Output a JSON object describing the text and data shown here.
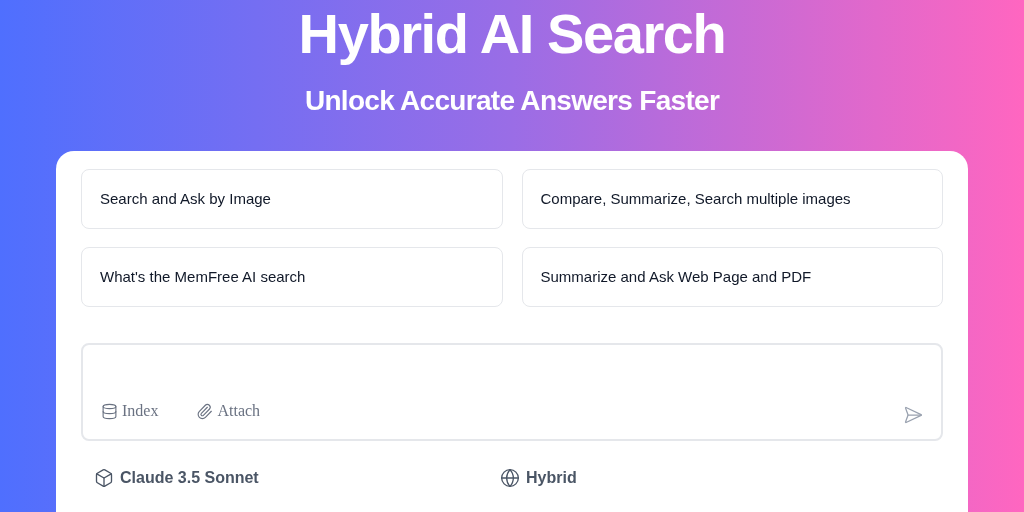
{
  "hero": {
    "title": "Hybrid AI Search",
    "subtitle": "Unlock Accurate Answers Faster"
  },
  "suggestions": [
    {
      "label": "Search and Ask by Image"
    },
    {
      "label": "Compare, Summarize, Search multiple images"
    },
    {
      "label": "What's the MemFree AI search"
    },
    {
      "label": "Summarize and Ask Web Page and PDF"
    }
  ],
  "input": {
    "actions": [
      {
        "kind": "index",
        "label": "Index"
      },
      {
        "kind": "attach",
        "label": "Attach"
      }
    ]
  },
  "footer": {
    "model": "Claude 3.5 Sonnet",
    "mode": "Hybrid"
  }
}
